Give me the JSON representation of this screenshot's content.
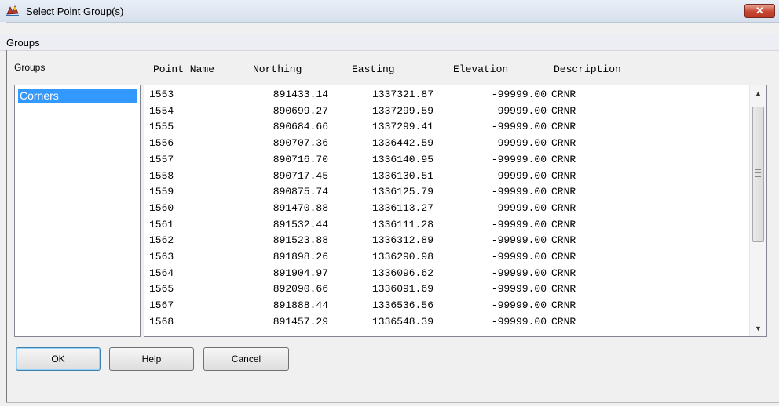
{
  "window": {
    "title": "Select Point Group(s)",
    "close_label": "✕"
  },
  "menu": {
    "groups_label": "Groups"
  },
  "groups_panel": {
    "label": "Groups",
    "items": [
      "Corners"
    ]
  },
  "columns": {
    "point_name": "Point Name",
    "northing": "Northing",
    "easting": "Easting",
    "elevation": "Elevation",
    "description": "Description"
  },
  "points": [
    [
      "1553",
      "891433.14",
      "1337321.87",
      "-99999.00",
      "CRNR"
    ],
    [
      "1554",
      "890699.27",
      "1337299.59",
      "-99999.00",
      "CRNR"
    ],
    [
      "1555",
      "890684.66",
      "1337299.41",
      "-99999.00",
      "CRNR"
    ],
    [
      "1556",
      "890707.36",
      "1336442.59",
      "-99999.00",
      "CRNR"
    ],
    [
      "1557",
      "890716.70",
      "1336140.95",
      "-99999.00",
      "CRNR"
    ],
    [
      "1558",
      "890717.45",
      "1336130.51",
      "-99999.00",
      "CRNR"
    ],
    [
      "1559",
      "890875.74",
      "1336125.79",
      "-99999.00",
      "CRNR"
    ],
    [
      "1560",
      "891470.88",
      "1336113.27",
      "-99999.00",
      "CRNR"
    ],
    [
      "1561",
      "891532.44",
      "1336111.28",
      "-99999.00",
      "CRNR"
    ],
    [
      "1562",
      "891523.88",
      "1336312.89",
      "-99999.00",
      "CRNR"
    ],
    [
      "1563",
      "891898.26",
      "1336290.98",
      "-99999.00",
      "CRNR"
    ],
    [
      "1564",
      "891904.97",
      "1336096.62",
      "-99999.00",
      "CRNR"
    ],
    [
      "1565",
      "892090.66",
      "1336091.69",
      "-99999.00",
      "CRNR"
    ],
    [
      "1567",
      "891888.44",
      "1336536.56",
      "-99999.00",
      "CRNR"
    ],
    [
      "1568",
      "891457.29",
      "1336548.39",
      "-99999.00",
      "CRNR"
    ]
  ],
  "buttons": {
    "ok": "OK",
    "help": "Help",
    "cancel": "Cancel"
  },
  "colors": {
    "selection": "#3399ff",
    "close_button": "#c74631"
  }
}
